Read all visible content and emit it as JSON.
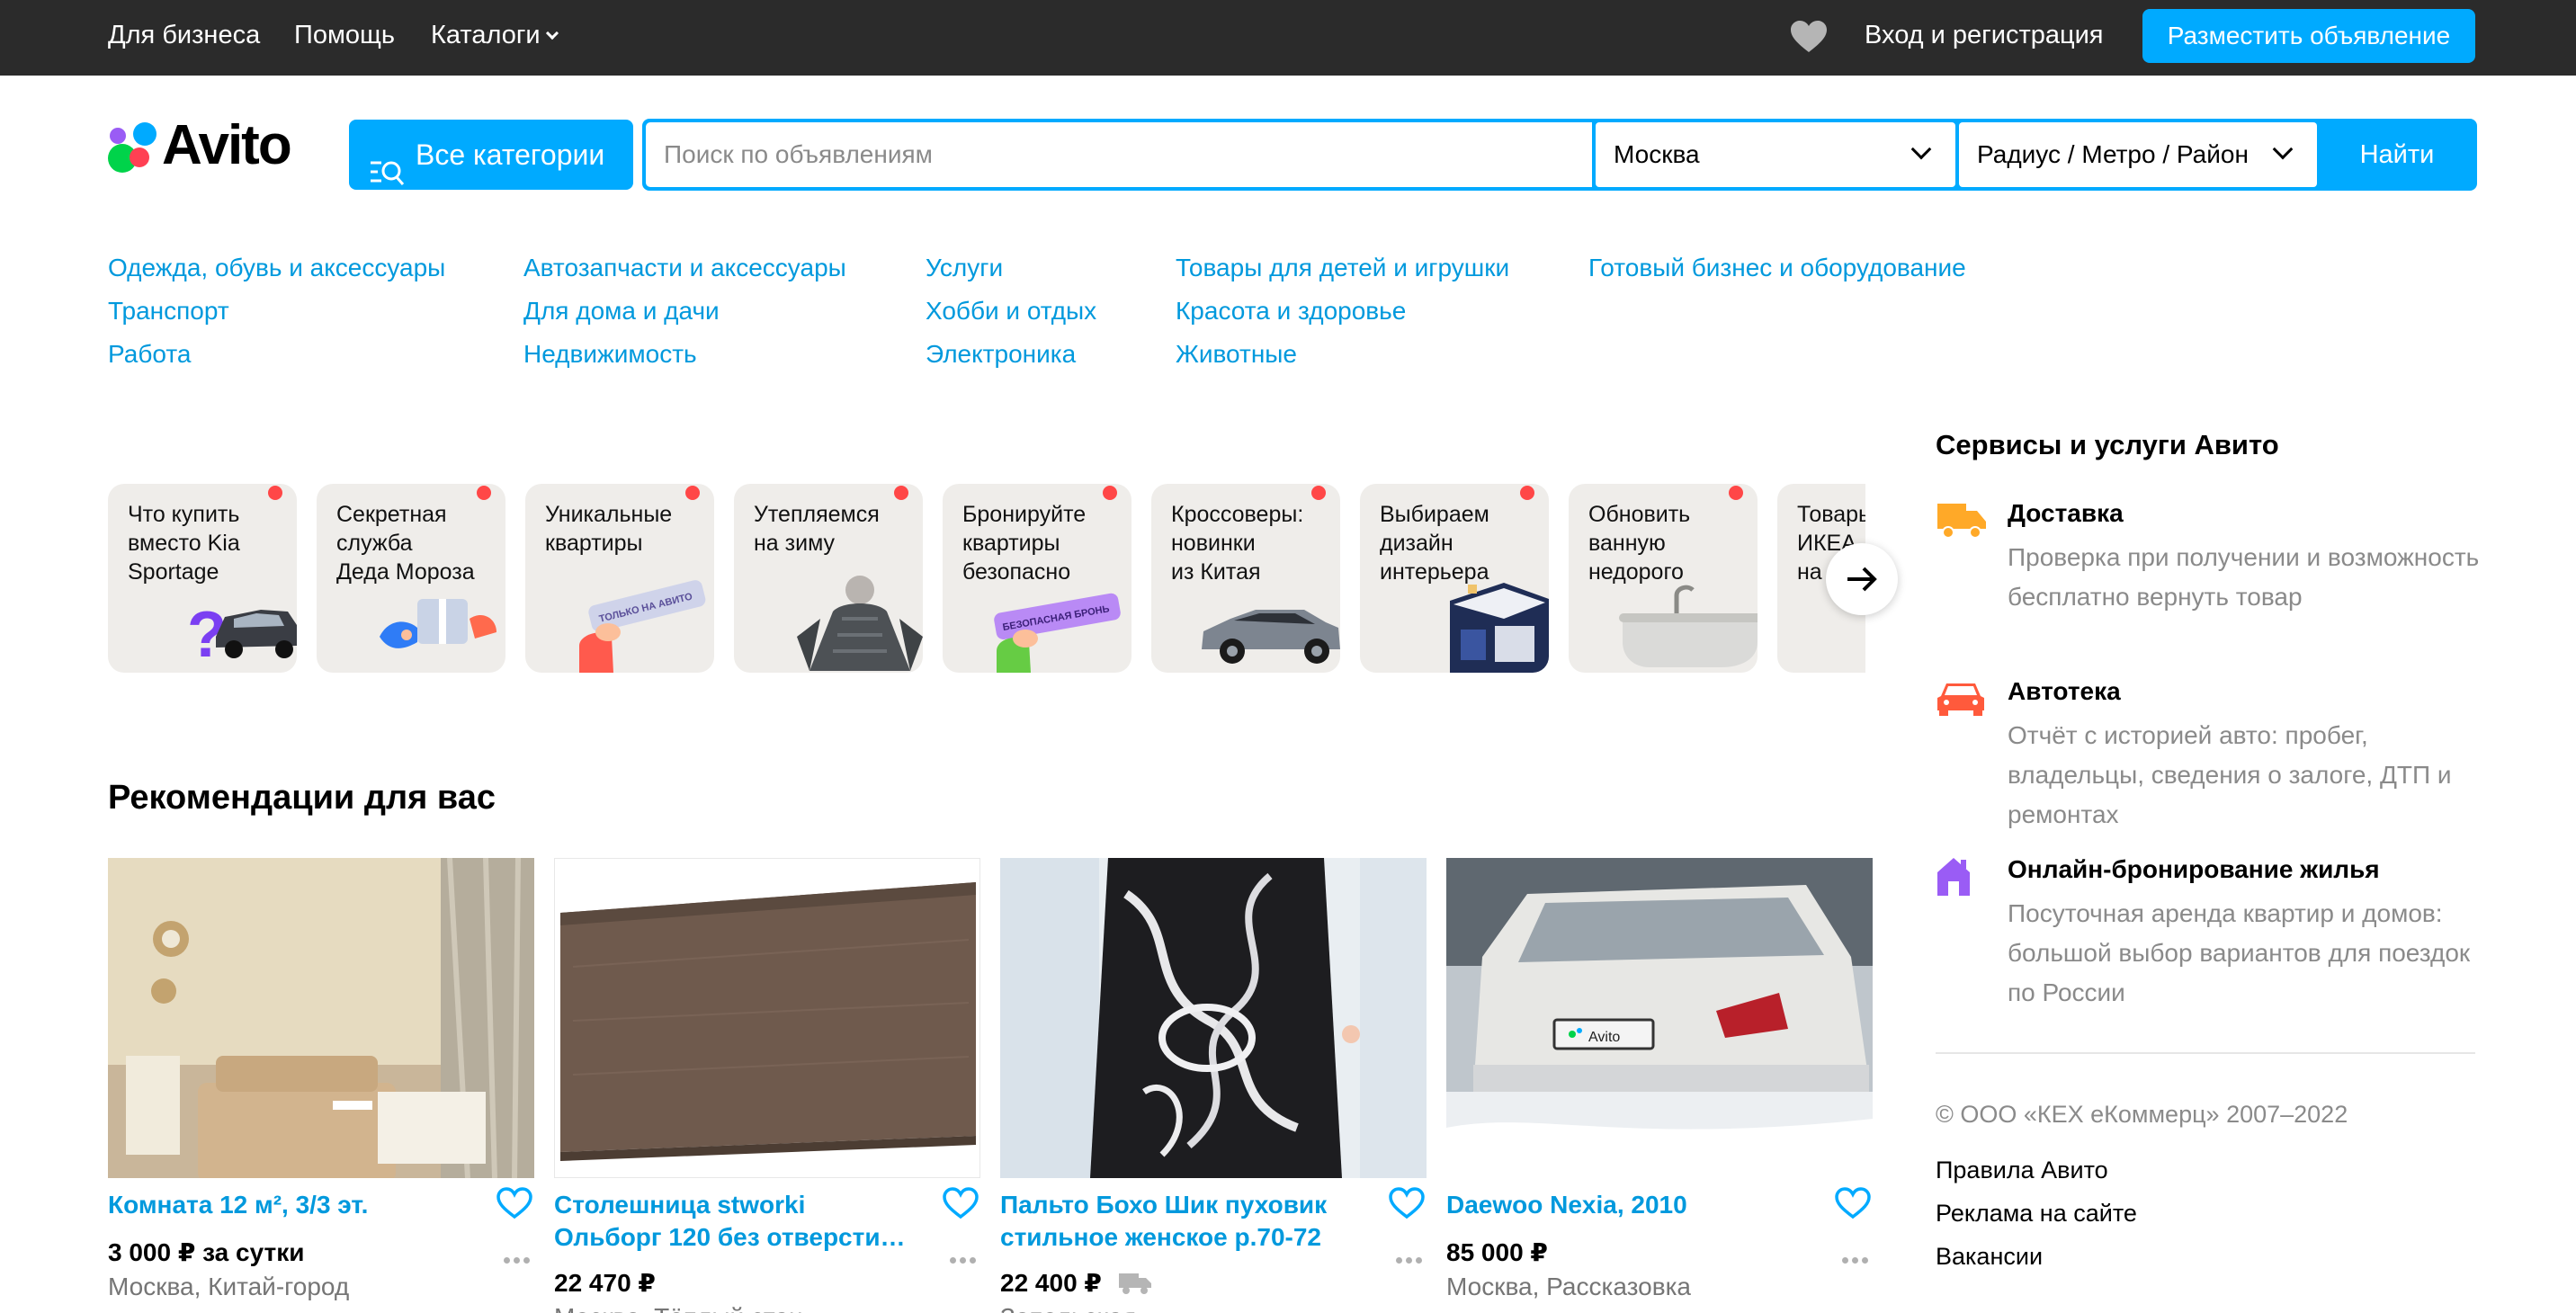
{
  "topbar": {
    "business": "Для бизнеса",
    "help": "Помощь",
    "catalogs": "Каталоги",
    "login": "Вход и регистрация",
    "post_ad": "Разместить объявление"
  },
  "header": {
    "logo_text": "Avito",
    "all_categories": "Все категории",
    "search_placeholder": "Поиск по объявлениям",
    "city": "Москва",
    "radius": "Радиус / Метро / Район",
    "find": "Найти"
  },
  "categories": [
    [
      "Одежда, обувь и аксессуары",
      "Транспорт",
      "Работа"
    ],
    [
      "Автозапчасти и аксессуары",
      "Для дома и дачи",
      "Недвижимость"
    ],
    [
      "Услуги",
      "Хобби и отдых",
      "Электроника"
    ],
    [
      "Товары для детей и игрушки",
      "Красота и здоровье",
      "Животные"
    ],
    [
      "Готовый бизнес и оборудование"
    ]
  ],
  "stories": [
    {
      "text": "Что купить\nвместо Kia\nSportage"
    },
    {
      "text": "Секретная\nслужба\nДеда Мороза"
    },
    {
      "text": "Уникальные\nквартиры",
      "badge": "ТОЛЬКО НА АВИТО"
    },
    {
      "text": "Утепляемся\nна зиму"
    },
    {
      "text": "Бронируйте\nквартиры\nбезопасно",
      "badge": "БЕЗОПАСНАЯ БРОНЬ"
    },
    {
      "text": "Кроссоверы:\nновинки\nиз Китая"
    },
    {
      "text": "Выбираем\nдизайн\nинтерьера"
    },
    {
      "text": "Обновить\nванную\nнедорого"
    },
    {
      "text": "Товары\nИКЕА\nна"
    }
  ],
  "recommendations": {
    "title": "Рекомендации для вас",
    "items": [
      {
        "title": "Комната 12 м², 3/3 эт.",
        "price": "3 000 ₽ за сутки",
        "location": "Москва, Китай-город"
      },
      {
        "title": "Столешница stworki Ольборг 120 без отверсти…",
        "price": "22 470 ₽",
        "location": "Москва, Тёплый стан"
      },
      {
        "title": "Пальто Бохо Шик пуховик стильное женское р.70-72",
        "price": "22 400 ₽",
        "location": "Запольская"
      },
      {
        "title": "Daewoo Nexia, 2010",
        "price": "85 000 ₽",
        "location": "Москва, Рассказовка"
      }
    ]
  },
  "services": {
    "title": "Сервисы и услуги Авито",
    "items": [
      {
        "name": "Доставка",
        "icon": "truck-icon",
        "color": "#ffa928",
        "desc": "Проверка при получении и возможность бесплатно вернуть товар"
      },
      {
        "name": "Автотека",
        "icon": "car-icon",
        "color": "#ff5a3c",
        "desc": "Отчёт с историей авто: пробег, владельцы, сведения о залоге, ДТП и ремонтах"
      },
      {
        "name": "Онлайн-бронирование жилья",
        "icon": "house-icon",
        "color": "#9a5cf5",
        "desc": "Посуточная аренда квартир и домов: большой выбор вариантов для поездок по России"
      }
    ]
  },
  "footer": {
    "copyright": "© ООО «КЕХ еКоммерц» 2007–2022",
    "links": [
      "Правила Авито",
      "Реклама на сайте",
      "Вакансии"
    ]
  },
  "colors": {
    "accent": "#00aaff",
    "link": "#0099dd",
    "topbar": "#2b2b2b",
    "story_dot": "#ff4747"
  }
}
